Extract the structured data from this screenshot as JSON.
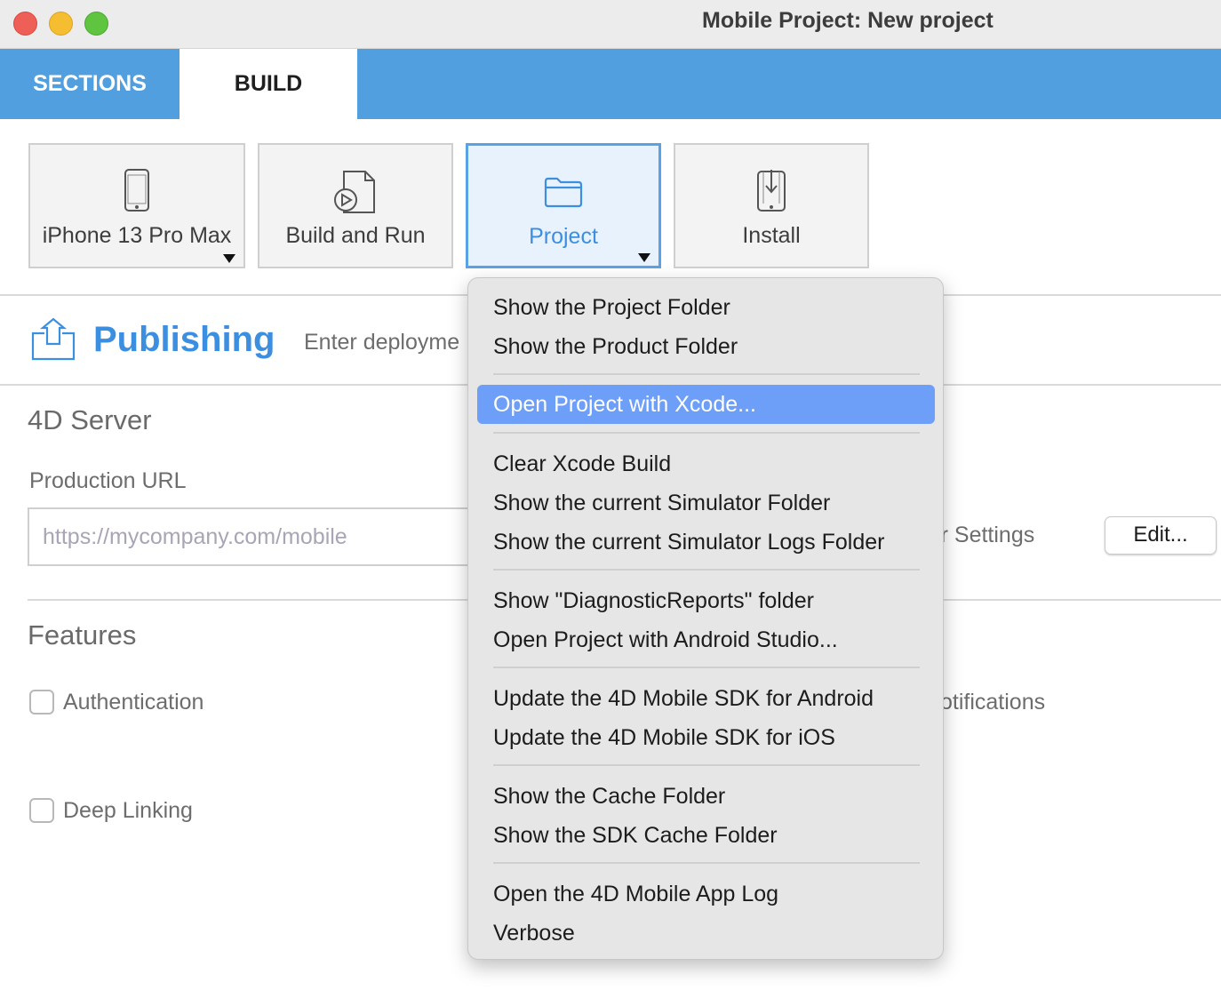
{
  "window": {
    "title": "Mobile Project: New project"
  },
  "tabs": {
    "sections": "SECTIONS",
    "build": "BUILD"
  },
  "toolbar": {
    "device": "iPhone 13 Pro Max",
    "build_run": "Build and Run",
    "project": "Project",
    "install": "Install"
  },
  "publishing": {
    "title": "Publishing",
    "description": "Enter deployme"
  },
  "server": {
    "heading": "4D Server",
    "production_url_label": "Production URL",
    "url_placeholder": "https://mycompany.com/mobile",
    "settings_label": "erver Settings",
    "edit_button": "Edit..."
  },
  "features": {
    "heading": "Features",
    "authentication": "Authentication",
    "deep_linking": "Deep Linking",
    "notifications": "otifications"
  },
  "menu": {
    "items": [
      "Show the Project Folder",
      "Show the Product Folder",
      "Open Project with Xcode...",
      "Clear Xcode Build",
      "Show the current Simulator Folder",
      "Show the current Simulator Logs Folder",
      "Show \"DiagnosticReports\" folder",
      "Open Project with Android Studio...",
      "Update the 4D Mobile SDK for Android",
      "Update the 4D Mobile SDK for iOS",
      "Show the Cache Folder",
      "Show the SDK Cache Folder",
      "Open the 4D Mobile App Log",
      "Verbose"
    ],
    "highlighted": "Open Project with Xcode..."
  },
  "colors": {
    "accent": "#529fe0",
    "highlight": "#6e9ff8",
    "title_blue": "#3c8fe0"
  }
}
